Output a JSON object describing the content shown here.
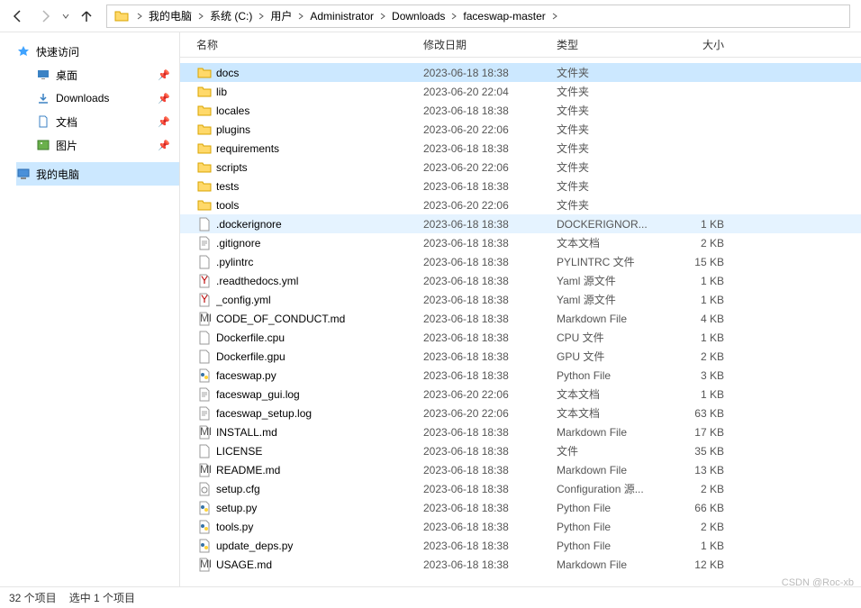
{
  "breadcrumb": {
    "items": [
      "我的电脑",
      "系统 (C:)",
      "用户",
      "Administrator",
      "Downloads",
      "faceswap-master"
    ]
  },
  "sidebar": {
    "quick_access": {
      "label": "快速访问",
      "icon": "star-icon"
    },
    "items": [
      {
        "label": "桌面",
        "icon": "desktop-icon",
        "pinned": true
      },
      {
        "label": "Downloads",
        "icon": "download-icon",
        "pinned": true
      },
      {
        "label": "文档",
        "icon": "document-icon",
        "pinned": true
      },
      {
        "label": "图片",
        "icon": "pictures-icon",
        "pinned": true
      }
    ],
    "my_pc": {
      "label": "我的电脑",
      "icon": "pc-icon"
    }
  },
  "columns": {
    "name": "名称",
    "date": "修改日期",
    "type": "类型",
    "size": "大小"
  },
  "files": [
    {
      "name": "docs",
      "date": "2023-06-18 18:38",
      "type": "文件夹",
      "size": "",
      "icon": "folder",
      "selected": true
    },
    {
      "name": "lib",
      "date": "2023-06-20 22:04",
      "type": "文件夹",
      "size": "",
      "icon": "folder"
    },
    {
      "name": "locales",
      "date": "2023-06-18 18:38",
      "type": "文件夹",
      "size": "",
      "icon": "folder"
    },
    {
      "name": "plugins",
      "date": "2023-06-20 22:06",
      "type": "文件夹",
      "size": "",
      "icon": "folder"
    },
    {
      "name": "requirements",
      "date": "2023-06-18 18:38",
      "type": "文件夹",
      "size": "",
      "icon": "folder"
    },
    {
      "name": "scripts",
      "date": "2023-06-20 22:06",
      "type": "文件夹",
      "size": "",
      "icon": "folder"
    },
    {
      "name": "tests",
      "date": "2023-06-18 18:38",
      "type": "文件夹",
      "size": "",
      "icon": "folder"
    },
    {
      "name": "tools",
      "date": "2023-06-20 22:06",
      "type": "文件夹",
      "size": "",
      "icon": "folder"
    },
    {
      "name": ".dockerignore",
      "date": "2023-06-18 18:38",
      "type": "DOCKERIGNOR...",
      "size": "1 KB",
      "icon": "file",
      "hovered": true
    },
    {
      "name": ".gitignore",
      "date": "2023-06-18 18:38",
      "type": "文本文档",
      "size": "2 KB",
      "icon": "text"
    },
    {
      "name": ".pylintrc",
      "date": "2023-06-18 18:38",
      "type": "PYLINTRC 文件",
      "size": "15 KB",
      "icon": "file"
    },
    {
      "name": ".readthedocs.yml",
      "date": "2023-06-18 18:38",
      "type": "Yaml 源文件",
      "size": "1 KB",
      "icon": "yaml"
    },
    {
      "name": "_config.yml",
      "date": "2023-06-18 18:38",
      "type": "Yaml 源文件",
      "size": "1 KB",
      "icon": "yaml"
    },
    {
      "name": "CODE_OF_CONDUCT.md",
      "date": "2023-06-18 18:38",
      "type": "Markdown File",
      "size": "4 KB",
      "icon": "md"
    },
    {
      "name": "Dockerfile.cpu",
      "date": "2023-06-18 18:38",
      "type": "CPU 文件",
      "size": "1 KB",
      "icon": "file"
    },
    {
      "name": "Dockerfile.gpu",
      "date": "2023-06-18 18:38",
      "type": "GPU 文件",
      "size": "2 KB",
      "icon": "file"
    },
    {
      "name": "faceswap.py",
      "date": "2023-06-18 18:38",
      "type": "Python File",
      "size": "3 KB",
      "icon": "py"
    },
    {
      "name": "faceswap_gui.log",
      "date": "2023-06-20 22:06",
      "type": "文本文档",
      "size": "1 KB",
      "icon": "text"
    },
    {
      "name": "faceswap_setup.log",
      "date": "2023-06-20 22:06",
      "type": "文本文档",
      "size": "63 KB",
      "icon": "text"
    },
    {
      "name": "INSTALL.md",
      "date": "2023-06-18 18:38",
      "type": "Markdown File",
      "size": "17 KB",
      "icon": "md"
    },
    {
      "name": "LICENSE",
      "date": "2023-06-18 18:38",
      "type": "文件",
      "size": "35 KB",
      "icon": "file"
    },
    {
      "name": "README.md",
      "date": "2023-06-18 18:38",
      "type": "Markdown File",
      "size": "13 KB",
      "icon": "md"
    },
    {
      "name": "setup.cfg",
      "date": "2023-06-18 18:38",
      "type": "Configuration 源...",
      "size": "2 KB",
      "icon": "cfg"
    },
    {
      "name": "setup.py",
      "date": "2023-06-18 18:38",
      "type": "Python File",
      "size": "66 KB",
      "icon": "py"
    },
    {
      "name": "tools.py",
      "date": "2023-06-18 18:38",
      "type": "Python File",
      "size": "2 KB",
      "icon": "py"
    },
    {
      "name": "update_deps.py",
      "date": "2023-06-18 18:38",
      "type": "Python File",
      "size": "1 KB",
      "icon": "py"
    },
    {
      "name": "USAGE.md",
      "date": "2023-06-18 18:38",
      "type": "Markdown File",
      "size": "12 KB",
      "icon": "md"
    }
  ],
  "status": {
    "total": "32 个项目",
    "selected": "选中 1 个项目"
  },
  "watermark": "CSDN @Roc-xb"
}
